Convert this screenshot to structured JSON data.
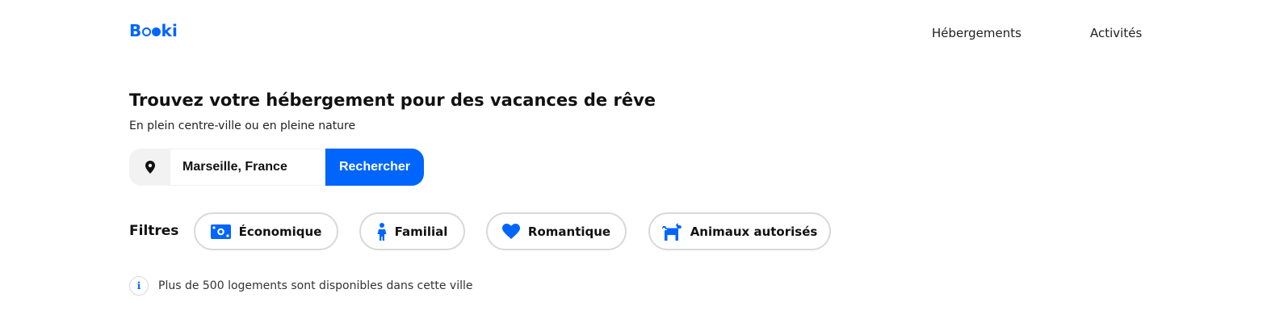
{
  "header": {
    "logo_text": "Booki",
    "nav": [
      {
        "label": "Hébergements"
      },
      {
        "label": "Activités"
      }
    ]
  },
  "hero": {
    "title": "Trouvez votre hébergement pour des vacances de rêve",
    "subtitle": "En plein centre-ville ou en pleine nature"
  },
  "search": {
    "icon": "location-pin-icon",
    "value": "Marseille, France",
    "button_label": "Rechercher"
  },
  "filters": {
    "label": "Filtres",
    "items": [
      {
        "label": "Économique",
        "icon": "money-icon"
      },
      {
        "label": "Familial",
        "icon": "child-icon"
      },
      {
        "label": "Romantique",
        "icon": "heart-icon"
      },
      {
        "label": "Animaux autorisés",
        "icon": "dog-icon"
      }
    ]
  },
  "info": {
    "icon": "info-icon",
    "icon_glyph": "i",
    "text": "Plus de 500 logements sont disponibles dans cette ville"
  },
  "colors": {
    "primary": "#0065fc",
    "chip_border": "#d9d9d9",
    "search_bg": "#f2f2f2"
  }
}
